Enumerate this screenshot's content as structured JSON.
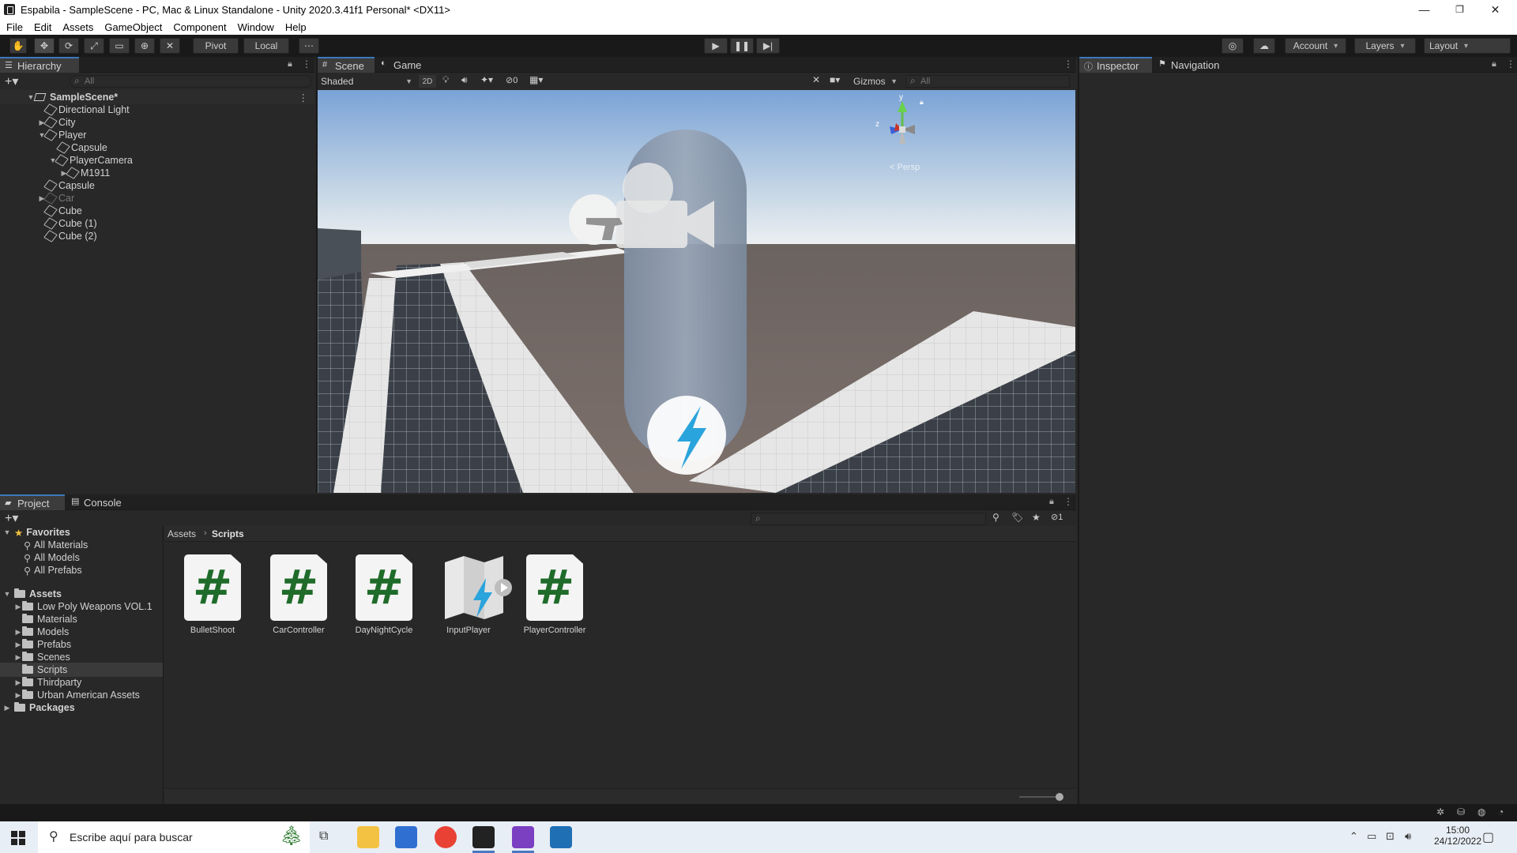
{
  "window": {
    "title": "Espabila - SampleScene - PC, Mac & Linux Standalone - Unity 2020.3.41f1 Personal* <DX11>",
    "controls": [
      "—",
      "❐",
      "✕"
    ]
  },
  "menu": [
    "File",
    "Edit",
    "Assets",
    "GameObject",
    "Component",
    "Window",
    "Help"
  ],
  "toolbar": {
    "pivot": "Pivot",
    "local": "Local",
    "account": "Account",
    "layers": "Layers",
    "layout": "Layout"
  },
  "hierarchy": {
    "tab": "Hierarchy",
    "search_placeholder": "All",
    "items": [
      {
        "label": "SampleScene*",
        "kind": "scene"
      },
      {
        "label": "Directional Light",
        "kind": "object"
      },
      {
        "label": "City",
        "kind": "object"
      },
      {
        "label": "Player",
        "kind": "object"
      },
      {
        "label": "Capsule",
        "kind": "object"
      },
      {
        "label": "PlayerCamera",
        "kind": "object"
      },
      {
        "label": "M1911",
        "kind": "object"
      },
      {
        "label": "Capsule",
        "kind": "object"
      },
      {
        "label": "Car",
        "kind": "object",
        "inactive": true
      },
      {
        "label": "Cube",
        "kind": "object"
      },
      {
        "label": "Cube (1)",
        "kind": "object"
      },
      {
        "label": "Cube (2)",
        "kind": "object"
      }
    ]
  },
  "scene": {
    "tabs": [
      "Scene",
      "Game"
    ],
    "shading": "Shaded",
    "mode_2d": "2D",
    "hidden_count": "0",
    "gizmos": "Gizmos",
    "search_placeholder": "All",
    "persp_label": "< Persp",
    "axis_y": "y",
    "axis_z": "z"
  },
  "inspector": {
    "tabs": [
      "Inspector",
      "Navigation"
    ]
  },
  "project": {
    "tabs": [
      "Project",
      "Console"
    ],
    "favorites_label": "Favorites",
    "favorites": [
      "All Materials",
      "All Models",
      "All Prefabs"
    ],
    "assets_label": "Assets",
    "folders": [
      "Low Poly Weapons VOL.1",
      "Materials",
      "Models",
      "Prefabs",
      "Scenes",
      "Scripts",
      "Thirdparty",
      "Urban American Assets"
    ],
    "packages_label": "Packages",
    "breadcrumb": [
      "Assets",
      "Scripts"
    ],
    "hidden_count": "1",
    "files": [
      {
        "name": "BulletShoot",
        "type": "script"
      },
      {
        "name": "CarController",
        "type": "script"
      },
      {
        "name": "DayNightCycle",
        "type": "script"
      },
      {
        "name": "InputPlayer",
        "type": "input"
      },
      {
        "name": "PlayerController",
        "type": "script"
      }
    ],
    "script_glyph": "#"
  },
  "taskbar": {
    "search_placeholder": "Escribe aquí para buscar",
    "time": "15:00",
    "date": "24/12/2022"
  },
  "colors": {
    "accent": "#3a79bb",
    "panel": "#282828",
    "header": "#202020"
  }
}
